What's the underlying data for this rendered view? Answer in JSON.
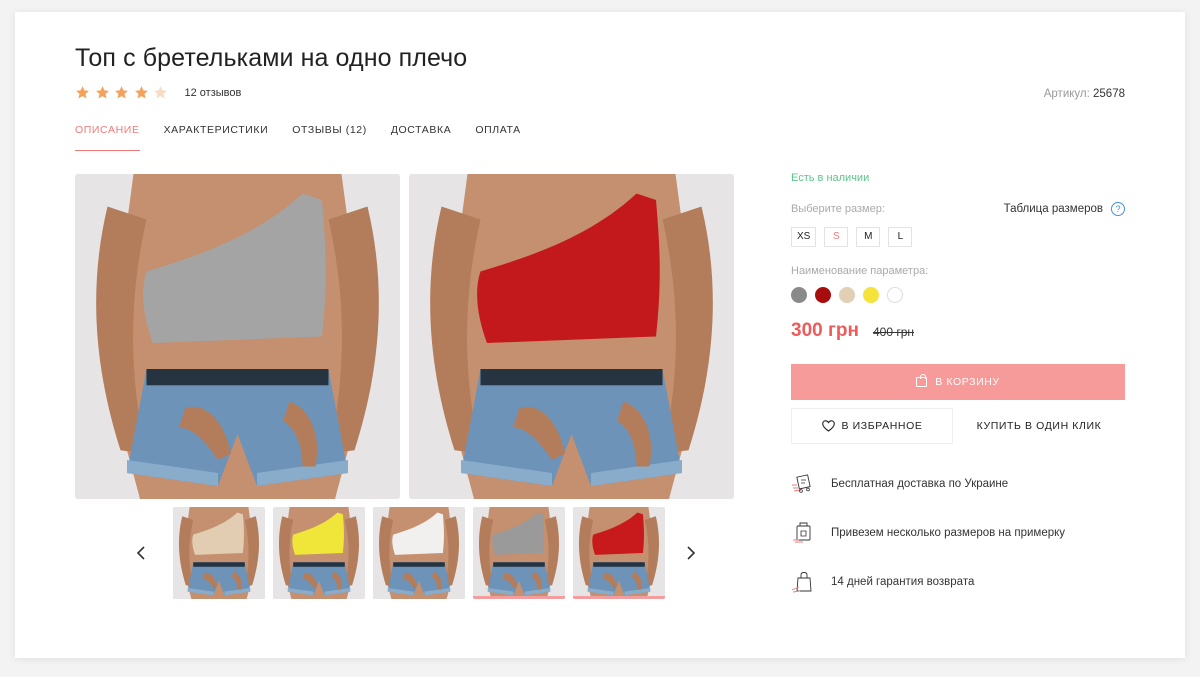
{
  "product": {
    "title": "Топ с бретельками на одно плечо",
    "rating": 4,
    "rating_max": 5,
    "reviews": "12 отзывов",
    "sku_label": "Артикул:",
    "sku_value": "25678"
  },
  "tabs": [
    {
      "label": "ОПИСАНИЕ",
      "active": true
    },
    {
      "label": "ХАРАКТЕРИСТИКИ",
      "active": false
    },
    {
      "label": "ОТЗЫВЫ (12)",
      "active": false
    },
    {
      "label": "ДОСТАВКА",
      "active": false
    },
    {
      "label": "ОПЛАТА",
      "active": false
    }
  ],
  "gallery": {
    "main_photos": [
      {
        "top_color": "#a4a4a4",
        "name": "grey-top-photo"
      },
      {
        "top_color": "#c4191c",
        "name": "red-top-photo"
      }
    ],
    "thumbnails": [
      {
        "top_color": "#e2cdb2",
        "active": false
      },
      {
        "top_color": "#f0e63a",
        "active": false
      },
      {
        "top_color": "#f2f0ee",
        "active": false
      },
      {
        "top_color": "#9a9a9a",
        "active": true
      },
      {
        "top_color": "#c8191c",
        "active": true
      }
    ],
    "prev_icon": "chevron-left-icon",
    "next_icon": "chevron-right-icon"
  },
  "purchase": {
    "stock": "Есть в наличии",
    "size_label": "Выберите размер:",
    "size_table": "Таблица размеров",
    "sizes": [
      {
        "label": "XS",
        "selected": false
      },
      {
        "label": "S",
        "selected": true
      },
      {
        "label": "M",
        "selected": false
      },
      {
        "label": "L",
        "selected": false
      }
    ],
    "param_label": "Наименование параметра:",
    "colors": [
      "#8a8a8a",
      "#a80d0d",
      "#e2cfb5",
      "#f5e23a",
      "#ffffff"
    ],
    "price": "300 грн",
    "old_price": "400 грн",
    "cart_button": "В КОРЗИНУ",
    "favorite_button": "В ИЗБРАННОЕ",
    "one_click_button": "КУПИТЬ В ОДИН КЛИК",
    "accent_color": "#f79a9a",
    "price_color": "#ee5b5b",
    "stock_color": "#5cc58a"
  },
  "features": [
    {
      "icon": "delivery-icon",
      "text": "Бесплатная доставка по Украине"
    },
    {
      "icon": "fitting-box-icon",
      "text": "Привезем несколько размеров на примерку"
    },
    {
      "icon": "shopping-bag-icon",
      "text": "14 дней гарантия возврата"
    }
  ]
}
